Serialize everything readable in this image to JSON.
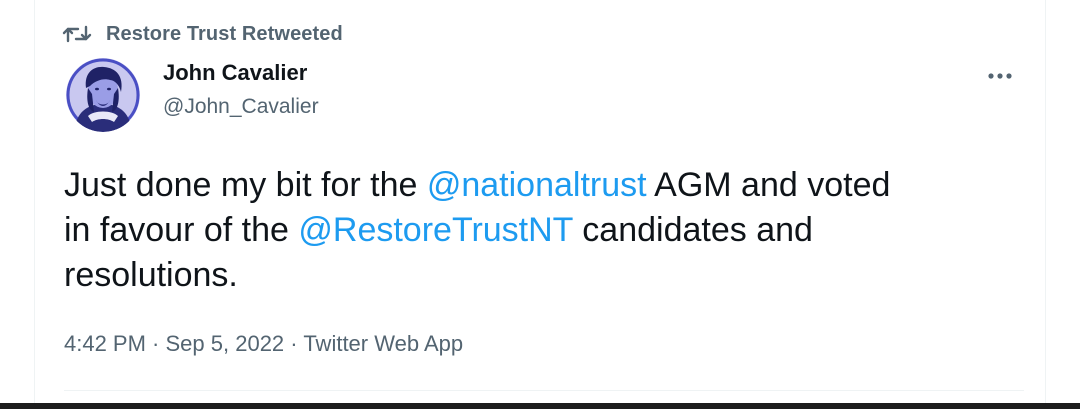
{
  "retweet": {
    "icon": "retweet-icon",
    "text": "Restore Trust Retweeted"
  },
  "author": {
    "avatar_icon": "portrait-avatar",
    "name": "John Cavalier",
    "handle": "@John_Cavalier"
  },
  "more_icon": "more-dots-icon",
  "tweet": {
    "segments": [
      {
        "text": "Just done my bit for the ",
        "type": "text"
      },
      {
        "text": "@nationaltrust",
        "type": "mention"
      },
      {
        "text": " AGM and voted",
        "type": "text"
      },
      {
        "text": "in favour of the ",
        "type": "text"
      },
      {
        "text": "@RestoreTrustNT",
        "type": "mention"
      },
      {
        "text": " candidates and",
        "type": "text"
      },
      {
        "text": "resolutions.",
        "type": "text"
      }
    ]
  },
  "meta": {
    "time": "4:42 PM",
    "sep1": " · ",
    "date": "Sep 5, 2022",
    "sep2": " · ",
    "source": "Twitter Web App"
  },
  "colors": {
    "accent": "#1d9bf0",
    "secondary_text": "#536471",
    "primary_text": "#0f1419",
    "avatar_tint": "#5b5fd6"
  }
}
